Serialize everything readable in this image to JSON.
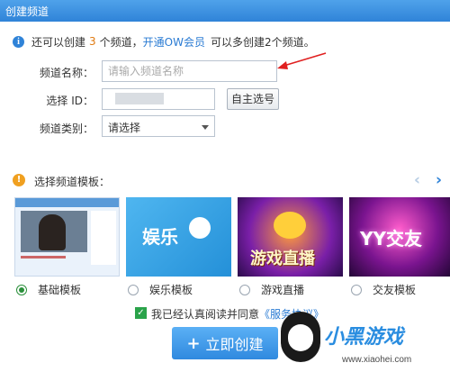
{
  "window": {
    "title": "创建频道"
  },
  "info": {
    "pre": "还可以创建",
    "count": "3",
    "mid": "个频道，",
    "link": "开通OW会员",
    "post": "可以多创建2个频道。"
  },
  "form": {
    "name_label": "频道名称：",
    "name_placeholder": "请输入频道名称",
    "id_label": "选择 ID：",
    "id_value": "",
    "choose_btn": "自主选号",
    "type_label": "频道类别：",
    "type_value": "请选择"
  },
  "template": {
    "title": "选择频道模板：",
    "items": [
      {
        "label": "基础模板",
        "selected": true,
        "thumb_text": ""
      },
      {
        "label": "娱乐模板",
        "selected": false,
        "thumb_text": "娱乐"
      },
      {
        "label": "游戏直播",
        "selected": false,
        "thumb_text": "游戏直播"
      },
      {
        "label": "交友模板",
        "selected": false,
        "thumb_text": "YY交友"
      }
    ]
  },
  "agreement": {
    "text": "我已经认真阅读并同意",
    "link": "《服务协议》",
    "checked": true
  },
  "create_btn": "立即创建",
  "watermark": {
    "brand": "小黑游戏",
    "url": "www.xiaohei.com"
  },
  "colors": {
    "accent": "#2f83d8",
    "highlight": "#e07a10",
    "link": "#2a7bd3",
    "check": "#2aa34a"
  }
}
